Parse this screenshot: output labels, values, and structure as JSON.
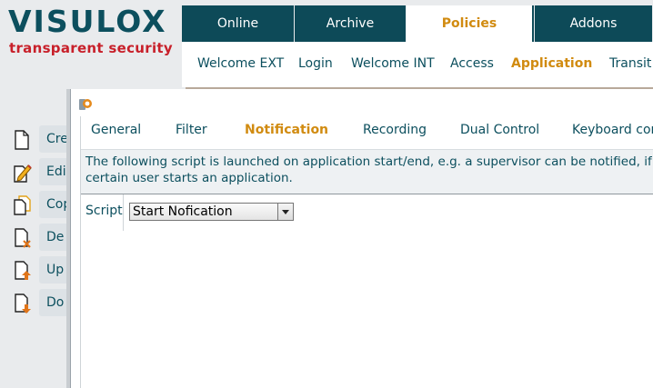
{
  "logo": {
    "main": "VISULOX",
    "sub": "transparent security"
  },
  "topnav": [
    {
      "label": "Online",
      "active": false
    },
    {
      "label": "Archive",
      "active": false
    },
    {
      "label": "Policies",
      "active": true
    },
    {
      "label": "Addons",
      "active": false
    }
  ],
  "subnav": [
    {
      "label": "Welcome EXT",
      "active": false
    },
    {
      "label": "Login",
      "active": false
    },
    {
      "label": "Welcome INT",
      "active": false
    },
    {
      "label": "Access",
      "active": false
    },
    {
      "label": "Application",
      "active": true
    },
    {
      "label": "Transit",
      "active": false
    }
  ],
  "actions": [
    {
      "label": "Cre",
      "icon": "new-document-icon"
    },
    {
      "label": "Edi",
      "icon": "edit-document-icon"
    },
    {
      "label": "Cop",
      "icon": "copy-document-icon"
    },
    {
      "label": "De",
      "icon": "delete-document-icon"
    },
    {
      "label": "Up",
      "icon": "upload-document-icon"
    },
    {
      "label": "Do",
      "icon": "download-document-icon"
    }
  ],
  "dialog": {
    "icon": "app-icon",
    "tabs": [
      {
        "label": "General",
        "active": false
      },
      {
        "label": "Filter",
        "active": false
      },
      {
        "label": "Notification",
        "active": true
      },
      {
        "label": "Recording",
        "active": false
      },
      {
        "label": "Dual Control",
        "active": false
      },
      {
        "label": "Keyboard control",
        "active": false
      }
    ],
    "info": "The following script is launched on application start/end, e.g. a supervisor can be notified, if a certain user starts an application.",
    "script_label": "Script",
    "script_value": "Start Nofication"
  },
  "colors": {
    "brand": "#0c4f5e",
    "accent": "#d18b10",
    "logo_red": "#c8202a",
    "nav_bg": "#0d4a58"
  }
}
